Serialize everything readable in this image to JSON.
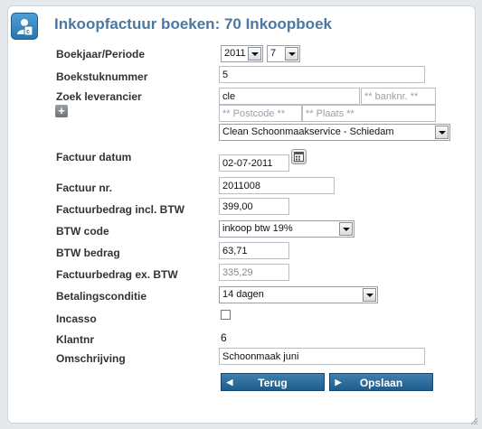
{
  "header": {
    "title": "Inkoopfactuur boeken: 70 Inkoopboek",
    "icon": "invoice-book-icon"
  },
  "form": {
    "boekjaar_label": "Boekjaar/Periode",
    "boekjaar_value": "2011",
    "periode_value": "7",
    "boekstuknummer_label": "Boekstuknummer",
    "boekstuknummer_value": "5",
    "leverancier_label": "Zoek leverancier",
    "leverancier_search_value": "cle",
    "banknr_placeholder": "** banknr. **",
    "postcode_placeholder": "** Postcode **",
    "plaats_placeholder": "** Plaats **",
    "leverancier_selected": "Clean Schoonmaakservice - Schiedam",
    "add_button_label": "+",
    "factuur_datum_label": "Factuur datum",
    "factuur_datum_value": "02-07-2011",
    "factuur_nr_label": "Factuur nr.",
    "factuur_nr_value": "2011008",
    "bedrag_incl_label": "Factuurbedrag incl. BTW",
    "bedrag_incl_value": "399,00",
    "btw_code_label": "BTW code",
    "btw_code_value": "inkoop btw 19%",
    "btw_bedrag_label": "BTW bedrag",
    "btw_bedrag_value": "63,71",
    "bedrag_ex_label": "Factuurbedrag ex. BTW",
    "bedrag_ex_value": "335,29",
    "betalingsconditie_label": "Betalingsconditie",
    "betalingsconditie_value": "14 dagen",
    "incasso_label": "Incasso",
    "incasso_checked": false,
    "klantnr_label": "Klantnr",
    "klantnr_value": "6",
    "omschrijving_label": "Omschrijving",
    "omschrijving_value": "Schoonmaak juni"
  },
  "actions": {
    "terug_label": "Terug",
    "opslaan_label": "Opslaan"
  },
  "colors": {
    "title": "#4a78a3",
    "button": "#2a6a9c"
  }
}
